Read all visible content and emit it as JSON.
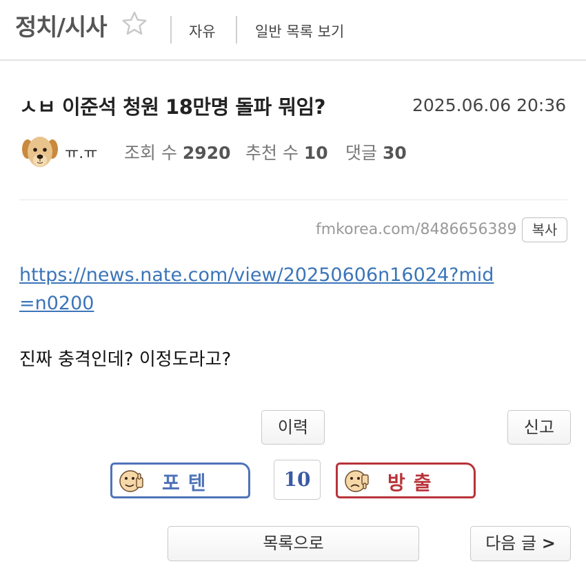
{
  "header": {
    "board_title": "정치/시사",
    "category": "자유",
    "list_view_label": "일반 목록 보기"
  },
  "post": {
    "title": "ㅅㅂ 이준석 청원 18만명 돌파 뭐임?",
    "date": "2025.06.06 20:36",
    "author": "ㅠ.ㅠ",
    "views_label": "조회 수",
    "views": "2920",
    "votes_label": "추천 수",
    "votes": "10",
    "comments_label": "댓글",
    "comments": "30",
    "permalink": "fmkorea.com/8486656389",
    "copy_label": "복사",
    "link": "https://news.nate.com/view/20250606n16024?mid=n0200",
    "body": "진짜 충격인데? 이정도라고?"
  },
  "actions": {
    "history_label": "이력",
    "report_label": "신고",
    "upvote_label": "포텐",
    "vote_count": "10",
    "downvote_label": "방출",
    "list_label": "목록으로",
    "next_label": "다음 글",
    "next_arrow": ">"
  },
  "colors": {
    "upvote": "#4f73b8",
    "downvote": "#b8333a",
    "link": "#3b75b8"
  }
}
